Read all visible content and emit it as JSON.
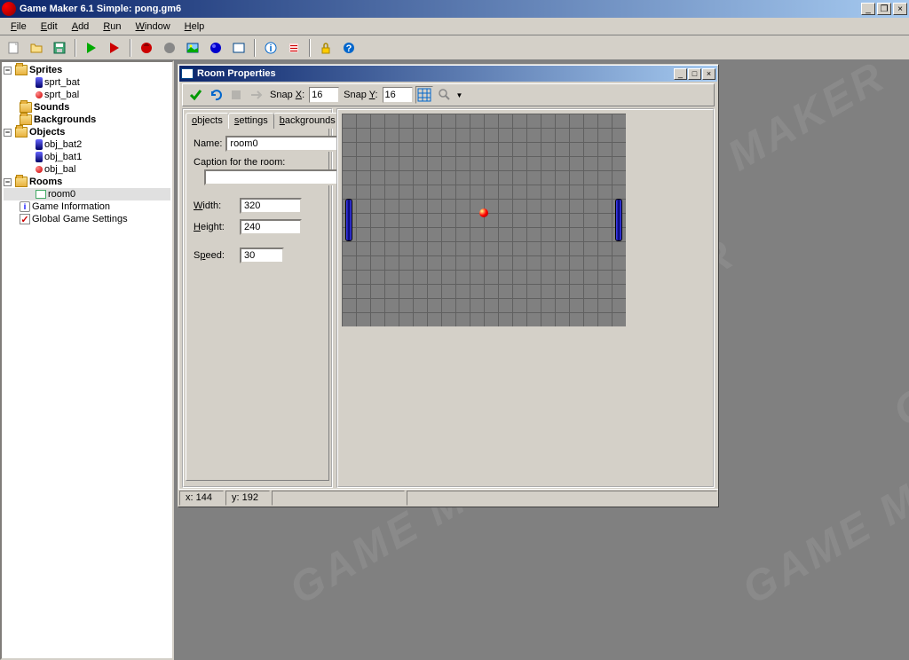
{
  "app": {
    "title": "Game Maker 6.1 Simple: pong.gm6"
  },
  "menu": {
    "file": "File",
    "edit": "Edit",
    "add": "Add",
    "run": "Run",
    "window": "Window",
    "help": "Help"
  },
  "tree": {
    "sprites": "Sprites",
    "sprt_bat": "sprt_bat",
    "sprt_bal": "sprt_bal",
    "sounds": "Sounds",
    "backgrounds": "Backgrounds",
    "objects": "Objects",
    "obj_bat2": "obj_bat2",
    "obj_bat1": "obj_bat1",
    "obj_bal": "obj_bal",
    "rooms": "Rooms",
    "room0": "room0",
    "game_info": "Game Information",
    "global_settings": "Global Game Settings"
  },
  "room_window": {
    "title": "Room Properties",
    "snapx_label": "Snap X:",
    "snapx_value": "16",
    "snapy_label": "Snap Y:",
    "snapy_value": "16",
    "tabs": {
      "objects": "objects",
      "settings": "settings",
      "backgrounds": "backgrounds"
    },
    "settings": {
      "name_label": "Name:",
      "name_value": "room0",
      "caption_label": "Caption for the room:",
      "caption_value": "",
      "width_label": "Width:",
      "width_value": "320",
      "height_label": "Height:",
      "height_value": "240",
      "speed_label": "Speed:",
      "speed_value": "30"
    },
    "status": {
      "x": "x: 144",
      "y": "y: 192"
    }
  },
  "watermark": "GAME MAKER"
}
